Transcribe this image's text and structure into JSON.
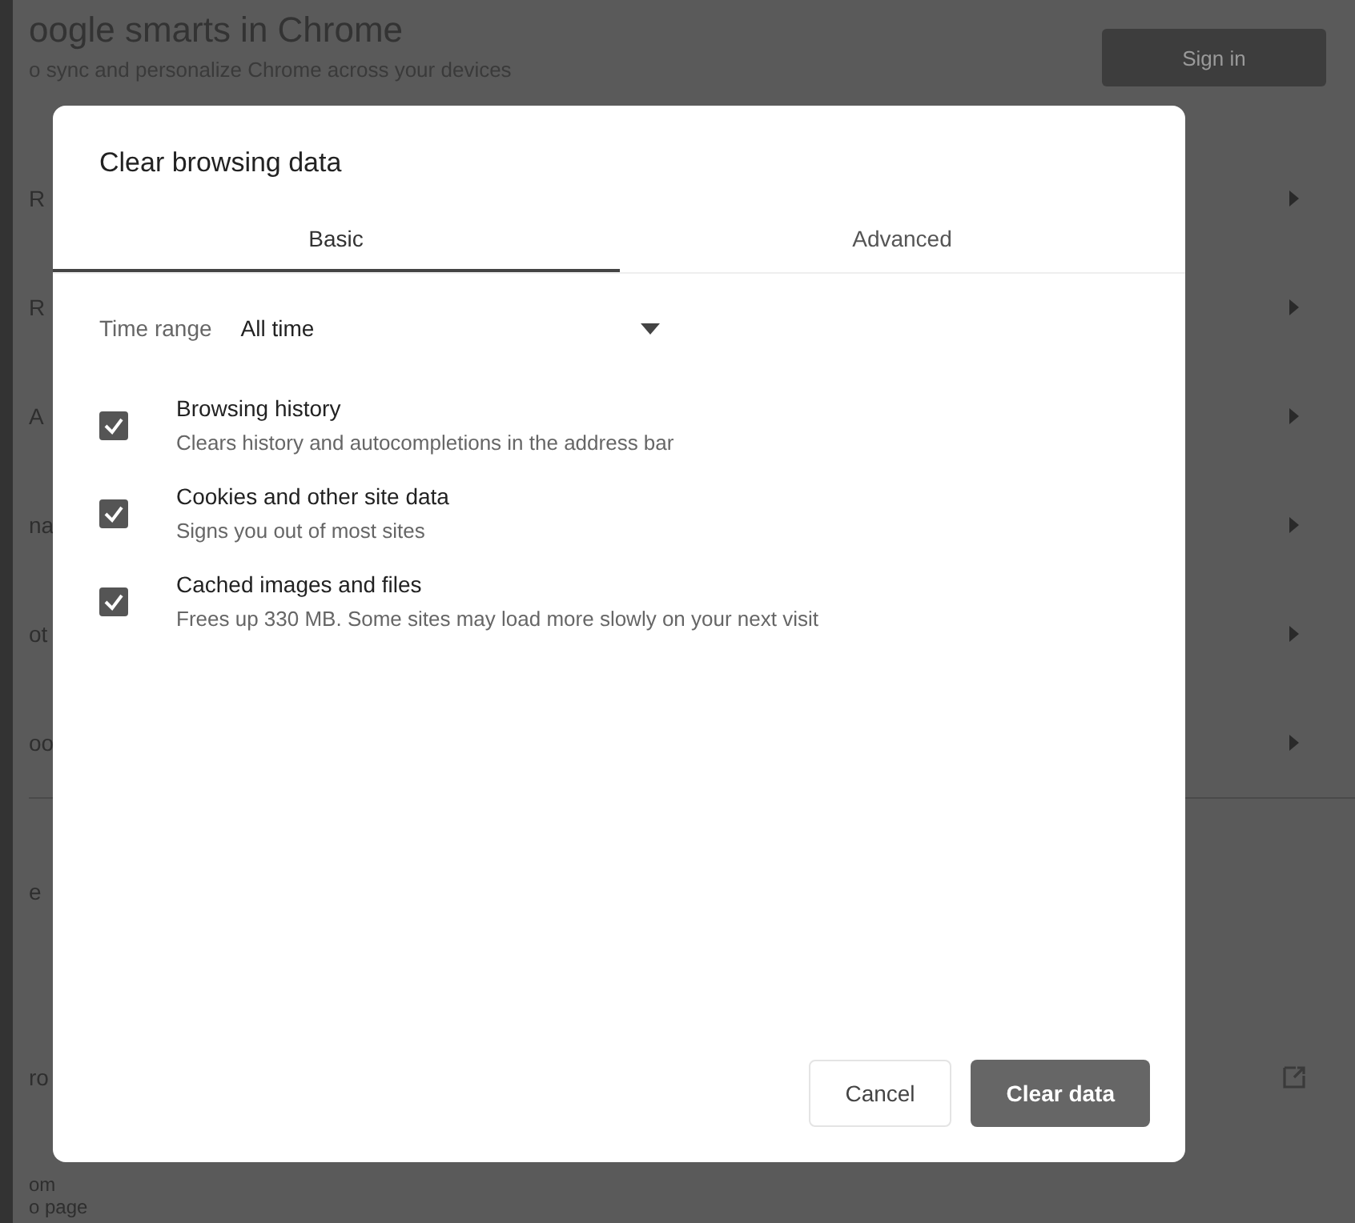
{
  "background": {
    "title": "oogle smarts in Chrome",
    "subtitle": "o sync and personalize Chrome across your devices",
    "sign_in_button": "Sign in",
    "rows": [
      {
        "label": "R"
      },
      {
        "label": "R"
      },
      {
        "label": "A"
      },
      {
        "label": "na"
      },
      {
        "label": "ot"
      },
      {
        "label": "oo"
      }
    ],
    "lower_rows": [
      {
        "label": "e",
        "kind": "plain"
      },
      {
        "label": "ro",
        "kind": "link"
      },
      {
        "label": "om",
        "kind": "plain"
      }
    ],
    "bottom_text": "o page"
  },
  "dialog": {
    "title": "Clear browsing data",
    "tabs": [
      {
        "label": "Basic",
        "selected": true
      },
      {
        "label": "Advanced",
        "selected": false
      }
    ],
    "time_range": {
      "label": "Time range",
      "value": "All time"
    },
    "options": [
      {
        "title": "Browsing history",
        "description": "Clears history and autocompletions in the address bar",
        "checked": true
      },
      {
        "title": "Cookies and other site data",
        "description": "Signs you out of most sites",
        "checked": true
      },
      {
        "title": "Cached images and files",
        "description": "Frees up 330 MB. Some sites may load more slowly on your next visit",
        "checked": true
      }
    ],
    "buttons": [
      {
        "label": "Cancel",
        "kind": "secondary"
      },
      {
        "label": "Clear data",
        "kind": "primary"
      }
    ]
  }
}
